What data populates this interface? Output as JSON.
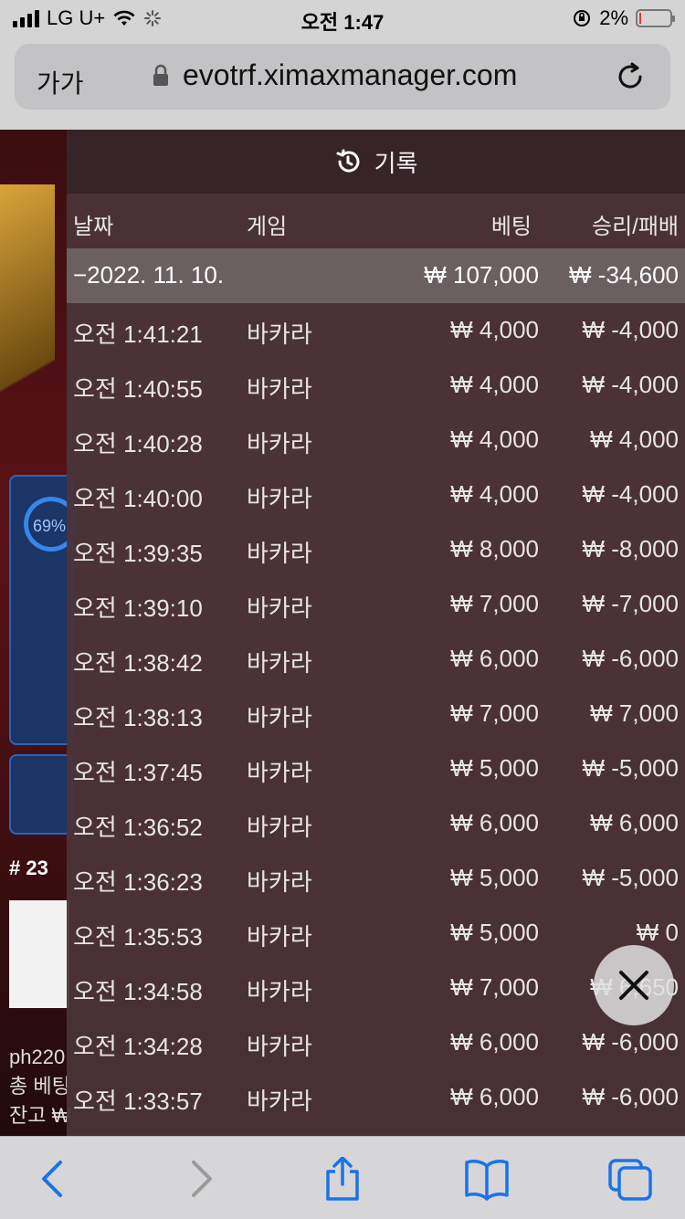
{
  "status_bar": {
    "carrier": "LG U+",
    "time": "오전 1:47",
    "battery": "2%",
    "battery_level": 0.02
  },
  "browser": {
    "text_size_button": "가가",
    "url": "evotrf.ximaxmanager.com"
  },
  "game_background": {
    "progress_label": "69%",
    "progress_value": 0.69,
    "table_number": "# 23",
    "user_lines": [
      "ph220",
      "총 베팅",
      "잔고 ₩"
    ]
  },
  "history": {
    "title": "기록",
    "columns": {
      "date": "날짜",
      "game": "게임",
      "bet": "베팅",
      "win_loss": "승리/패배"
    },
    "summary": {
      "date": "−2022. 11. 10.",
      "bet": "₩ 107,000",
      "win_loss": "₩ -34,600"
    },
    "rows": [
      {
        "time": "오전 1:41:21",
        "game": "바카라",
        "bet": "₩ 4,000",
        "result": "₩ -4,000"
      },
      {
        "time": "오전 1:40:55",
        "game": "바카라",
        "bet": "₩ 4,000",
        "result": "₩ -4,000"
      },
      {
        "time": "오전 1:40:28",
        "game": "바카라",
        "bet": "₩ 4,000",
        "result": "₩ 4,000"
      },
      {
        "time": "오전 1:40:00",
        "game": "바카라",
        "bet": "₩ 4,000",
        "result": "₩ -4,000"
      },
      {
        "time": "오전 1:39:35",
        "game": "바카라",
        "bet": "₩ 8,000",
        "result": "₩ -8,000"
      },
      {
        "time": "오전 1:39:10",
        "game": "바카라",
        "bet": "₩ 7,000",
        "result": "₩ -7,000"
      },
      {
        "time": "오전 1:38:42",
        "game": "바카라",
        "bet": "₩ 6,000",
        "result": "₩ -6,000"
      },
      {
        "time": "오전 1:38:13",
        "game": "바카라",
        "bet": "₩ 7,000",
        "result": "₩ 7,000"
      },
      {
        "time": "오전 1:37:45",
        "game": "바카라",
        "bet": "₩ 5,000",
        "result": "₩ -5,000"
      },
      {
        "time": "오전 1:36:52",
        "game": "바카라",
        "bet": "₩ 6,000",
        "result": "₩ 6,000"
      },
      {
        "time": "오전 1:36:23",
        "game": "바카라",
        "bet": "₩ 5,000",
        "result": "₩ -5,000"
      },
      {
        "time": "오전 1:35:53",
        "game": "바카라",
        "bet": "₩ 5,000",
        "result": "₩ 0"
      },
      {
        "time": "오전 1:34:58",
        "game": "바카라",
        "bet": "₩ 7,000",
        "result": "₩ 6,650"
      },
      {
        "time": "오전 1:34:28",
        "game": "바카라",
        "bet": "₩ 6,000",
        "result": "₩ -6,000"
      },
      {
        "time": "오전 1:33:57",
        "game": "바카라",
        "bet": "₩ 6,000",
        "result": "₩ -6,000"
      }
    ]
  },
  "icons": {
    "history": "history-icon",
    "close": "close-icon",
    "back": "chevron-left-icon",
    "forward": "chevron-right-icon",
    "share": "share-icon",
    "bookmarks": "book-icon",
    "tabs": "tabs-icon",
    "lock": "lock-icon",
    "reload": "reload-icon"
  },
  "colors": {
    "ios_blue": "#1a73e8",
    "overlay": "#4a3438",
    "summary_row": "#6a5f61",
    "battery_low": "#e8362d"
  }
}
